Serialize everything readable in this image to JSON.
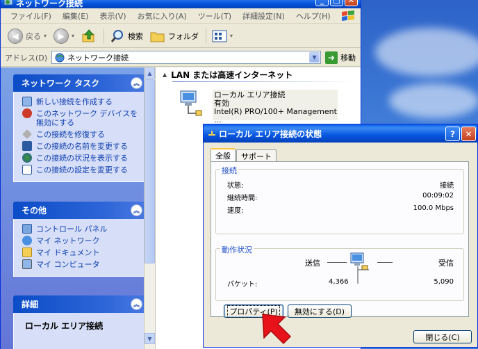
{
  "explorer": {
    "title": "ネットワーク接続",
    "menu": [
      "ファイル(F)",
      "編集(E)",
      "表示(V)",
      "お気に入り(A)",
      "ツール(T)",
      "詳細設定(N)",
      "ヘルプ(H)"
    ],
    "toolbar": {
      "back": "戻る",
      "search": "検索",
      "folders": "フォルダ"
    },
    "address": {
      "label": "アドレス(D)",
      "value": "ネットワーク接続",
      "go": "移動"
    }
  },
  "taskpane": {
    "network_tasks": {
      "title": "ネットワーク タスク",
      "items": [
        "新しい接続を作成する",
        "このネットワーク デバイスを無効にする",
        "この接続を修復する",
        "この接続の名前を変更する",
        "この接続の状況を表示する",
        "この接続の設定を変更する"
      ]
    },
    "other_places": {
      "title": "その他",
      "items": [
        "コントロール パネル",
        "マイ ネットワーク",
        "マイ ドキュメント",
        "マイ コンピュータ"
      ]
    },
    "details": {
      "title": "詳細",
      "name": "ローカル エリア接続"
    }
  },
  "content": {
    "group_title": "LAN または高速インターネット",
    "connection": {
      "name": "ローカル エリア接続",
      "status": "有効",
      "device": "Intel(R) PRO/100+ Management ..."
    }
  },
  "dialog": {
    "title": "ローカル エリア接続の状態",
    "tabs": [
      "全般",
      "サポート"
    ],
    "connection": {
      "legend": "接続",
      "status_label": "状態:",
      "status_value": "接続",
      "duration_label": "継続時間:",
      "duration_value": "00:09:02",
      "speed_label": "速度:",
      "speed_value": "100.0 Mbps"
    },
    "activity": {
      "legend": "動作状況",
      "sent_label": "送信",
      "received_label": "受信",
      "packets_label": "パケット:",
      "packets_sent": "4,366",
      "packets_received": "5,090"
    },
    "buttons": {
      "properties": "プロパティ(P)",
      "disable": "無効にする(D)",
      "close": "閉じる(C)"
    }
  },
  "colors": {
    "accent": "#0a5fe8",
    "link": "#0c3bae",
    "legend": "#2150c8",
    "arrow": "#e8121a"
  }
}
